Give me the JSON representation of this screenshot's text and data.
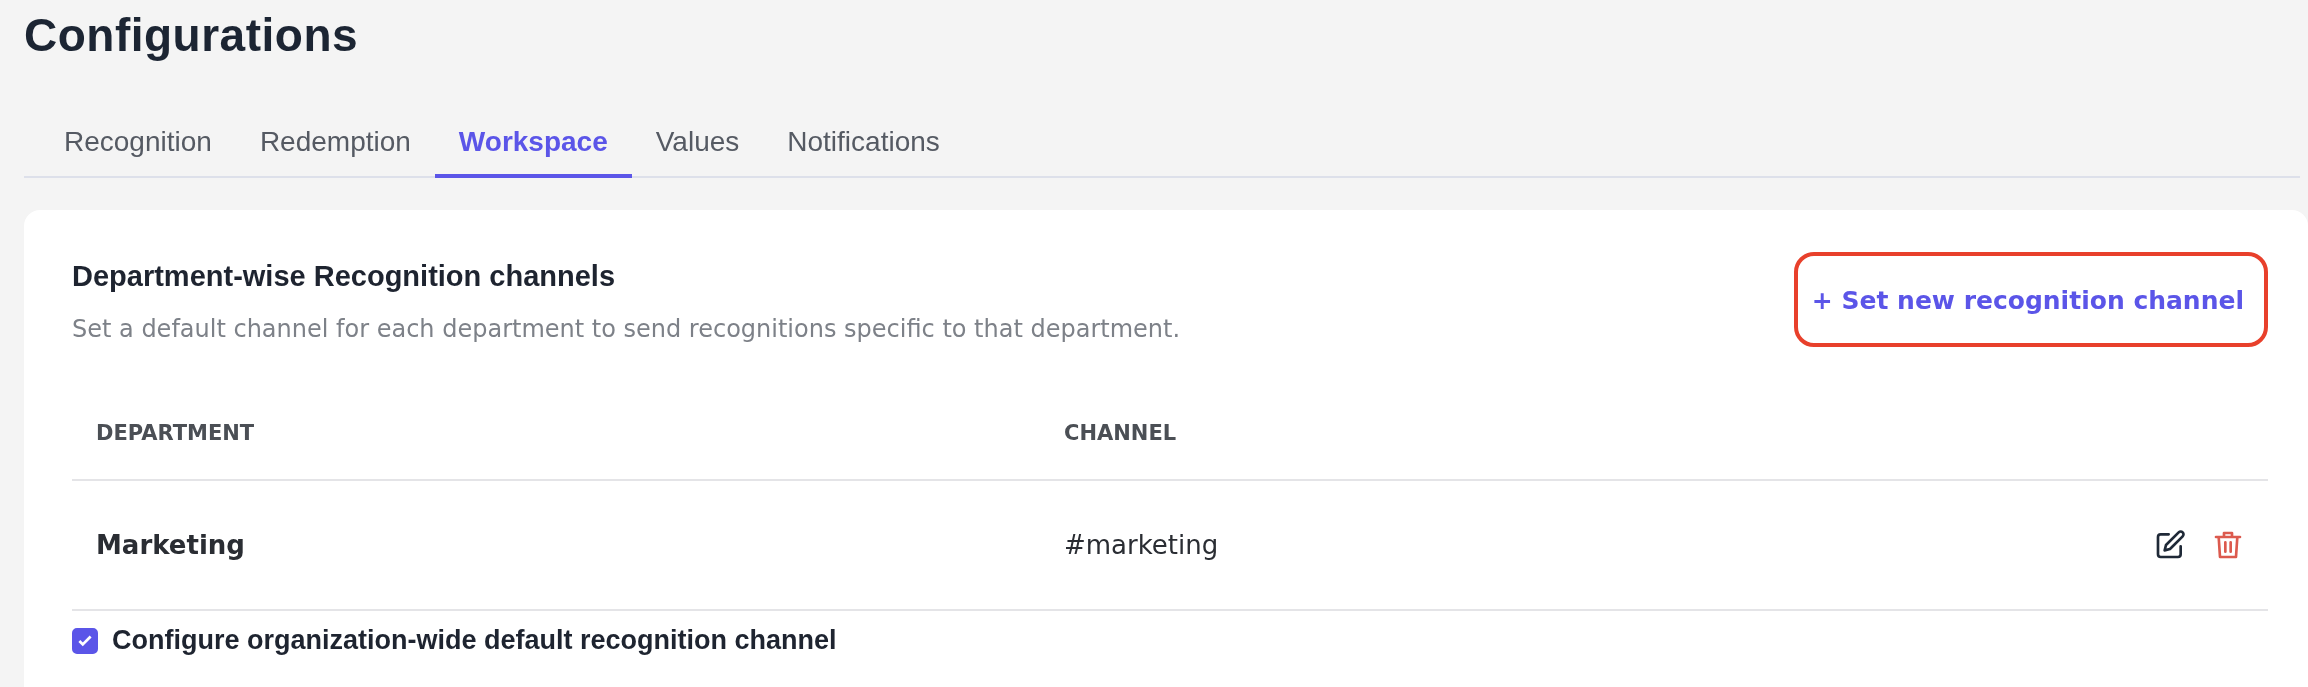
{
  "page": {
    "title": "Configurations"
  },
  "tabs": [
    {
      "label": "Recognition",
      "selected": false
    },
    {
      "label": "Redemption",
      "selected": false
    },
    {
      "label": "Workspace",
      "selected": true
    },
    {
      "label": "Values",
      "selected": false
    },
    {
      "label": "Notifications",
      "selected": false
    }
  ],
  "section": {
    "title": "Department-wise Recognition channels",
    "description": "Set a default channel for each department to send recognitions specific to that department.",
    "action": "+ Set new recognition channel"
  },
  "table": {
    "columns": [
      "DEPARTMENT",
      "CHANNEL"
    ],
    "rows": [
      {
        "department": "Marketing",
        "channel": "#marketing"
      }
    ]
  },
  "org_default": {
    "label": "Configure organization-wide default recognition channel",
    "checked": true
  }
}
